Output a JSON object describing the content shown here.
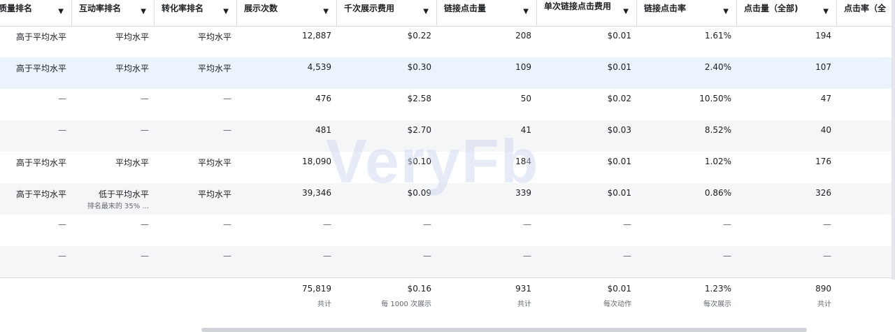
{
  "columns": [
    {
      "key": "quality",
      "label": "质量排名",
      "visible_label": "质量排名"
    },
    {
      "key": "engagement",
      "label": "互动率排名"
    },
    {
      "key": "conversion",
      "label": "转化率排名"
    },
    {
      "key": "impressions",
      "label": "展示次数"
    },
    {
      "key": "cpm",
      "label": "千次展示费用"
    },
    {
      "key": "link_clicks",
      "label": "链接点击量"
    },
    {
      "key": "cpc_link",
      "label": "单次链接点击费用"
    },
    {
      "key": "ctr_link",
      "label": "链接点击率"
    },
    {
      "key": "clicks_all",
      "label": "点击量（全部)"
    },
    {
      "key": "ctr_all",
      "label": "点击率（全"
    }
  ],
  "rows": [
    {
      "quality": "高于平均水平",
      "engagement": "平均水平",
      "conversion": "平均水平",
      "impressions": "12,887",
      "cpm": "$0.22",
      "link_clicks": "208",
      "cpc_link": "$0.01",
      "ctr_link": "1.61%",
      "clicks_all": "194",
      "ctr_all": ""
    },
    {
      "quality": "高于平均水平",
      "engagement": "平均水平",
      "conversion": "平均水平",
      "impressions": "4,539",
      "cpm": "$0.30",
      "link_clicks": "109",
      "cpc_link": "$0.01",
      "ctr_link": "2.40%",
      "clicks_all": "107",
      "ctr_all": ""
    },
    {
      "quality": "—",
      "engagement": "—",
      "conversion": "—",
      "impressions": "476",
      "cpm": "$2.58",
      "link_clicks": "50",
      "cpc_link": "$0.02",
      "ctr_link": "10.50%",
      "clicks_all": "47",
      "ctr_all": ""
    },
    {
      "quality": "—",
      "engagement": "—",
      "conversion": "—",
      "impressions": "481",
      "cpm": "$2.70",
      "link_clicks": "41",
      "cpc_link": "$0.03",
      "ctr_link": "8.52%",
      "clicks_all": "40",
      "ctr_all": ""
    },
    {
      "quality": "高于平均水平",
      "engagement": "平均水平",
      "conversion": "平均水平",
      "impressions": "18,090",
      "cpm": "$0.10",
      "link_clicks": "184",
      "cpc_link": "$0.01",
      "ctr_link": "1.02%",
      "clicks_all": "176",
      "ctr_all": ""
    },
    {
      "quality": "高于平均水平",
      "engagement": "低于平均水平",
      "engagement_sub": "排名最末的 35% ...",
      "conversion": "平均水平",
      "impressions": "39,346",
      "cpm": "$0.09",
      "link_clicks": "339",
      "cpc_link": "$0.01",
      "ctr_link": "0.86%",
      "clicks_all": "326",
      "ctr_all": ""
    },
    {
      "quality": "—",
      "engagement": "—",
      "conversion": "—",
      "impressions": "—",
      "cpm": "—",
      "link_clicks": "—",
      "cpc_link": "—",
      "ctr_link": "—",
      "clicks_all": "—",
      "ctr_all": ""
    },
    {
      "quality": "—",
      "engagement": "—",
      "conversion": "—",
      "impressions": "—",
      "cpm": "—",
      "link_clicks": "—",
      "cpc_link": "—",
      "ctr_link": "—",
      "clicks_all": "—",
      "ctr_all": ""
    }
  ],
  "totals": {
    "impressions": {
      "value": "75,819",
      "sub": "共计"
    },
    "cpm": {
      "value": "$0.16",
      "sub": "每 1000 次展示"
    },
    "link_clicks": {
      "value": "931",
      "sub": "共计"
    },
    "cpc_link": {
      "value": "$0.01",
      "sub": "每次动作"
    },
    "ctr_link": {
      "value": "1.23%",
      "sub": "每次展示"
    },
    "clicks_all": {
      "value": "890",
      "sub": "共计"
    }
  },
  "watermark": "VeryFb",
  "sort_icon": "caret-down-icon",
  "colors": {
    "header_border": "#dadde1",
    "row_alt": "#f5f6f7",
    "row_highlight": "#ebf3fd",
    "muted": "#606770"
  }
}
